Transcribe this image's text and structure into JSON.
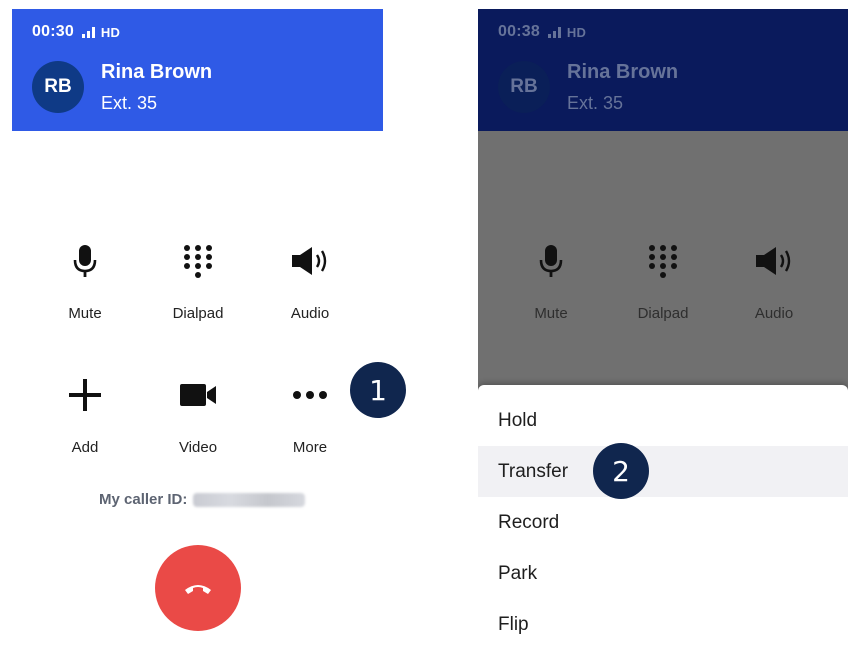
{
  "left_phone": {
    "status": {
      "time": "00:30",
      "network": "HD"
    },
    "caller": {
      "initials": "RB",
      "name": "Rina Brown",
      "ext": "Ext. 35"
    },
    "controls": [
      "Mute",
      "Dialpad",
      "Audio",
      "Add",
      "Video",
      "More"
    ],
    "caller_id_label": "My caller ID:",
    "step_badge": "1"
  },
  "right_phone": {
    "status": {
      "time": "00:38",
      "network": "HD"
    },
    "caller": {
      "initials": "RB",
      "name": "Rina Brown",
      "ext": "Ext. 35"
    },
    "controls": [
      "Mute",
      "Dialpad",
      "Audio"
    ],
    "menu": [
      "Hold",
      "Transfer",
      "Record",
      "Park",
      "Flip"
    ],
    "step_badge": "2"
  },
  "colors": {
    "header_blue": "#2f5ae6",
    "hangup_red": "#ea4a47",
    "badge_navy": "#10264e"
  }
}
